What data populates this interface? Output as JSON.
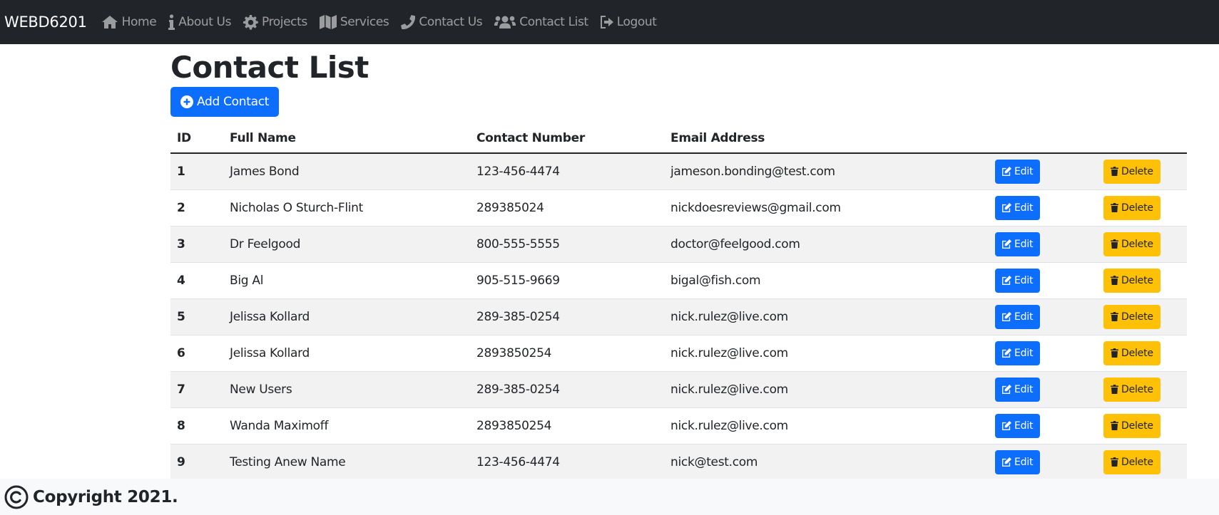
{
  "navbar": {
    "brand": "WEBD6201",
    "links": [
      {
        "label": "Home",
        "icon": "home-icon"
      },
      {
        "label": "About Us",
        "icon": "info-icon"
      },
      {
        "label": "Projects",
        "icon": "gear-icon"
      },
      {
        "label": "Services",
        "icon": "map-icon"
      },
      {
        "label": "Contact Us",
        "icon": "phone-icon"
      },
      {
        "label": "Contact List",
        "icon": "users-icon"
      },
      {
        "label": "Logout",
        "icon": "sign-out-icon"
      }
    ]
  },
  "main": {
    "title": "Contact List",
    "add_button": "Add Contact",
    "table": {
      "headers": [
        "ID",
        "Full Name",
        "Contact Number",
        "Email Address"
      ],
      "rows": [
        {
          "id": "1",
          "name": "James Bond",
          "number": "123-456-4474",
          "email": "jameson.bonding@test.com"
        },
        {
          "id": "2",
          "name": "Nicholas O Sturch-Flint",
          "number": "289385024",
          "email": "nickdoesreviews@gmail.com"
        },
        {
          "id": "3",
          "name": "Dr Feelgood",
          "number": "800-555-5555",
          "email": "doctor@feelgood.com"
        },
        {
          "id": "4",
          "name": "Big Al",
          "number": "905-515-9669",
          "email": "bigal@fish.com"
        },
        {
          "id": "5",
          "name": "Jelissa Kollard",
          "number": "289-385-0254",
          "email": "nick.rulez@live.com"
        },
        {
          "id": "6",
          "name": "Jelissa Kollard",
          "number": "2893850254",
          "email": "nick.rulez@live.com"
        },
        {
          "id": "7",
          "name": "New Users",
          "number": "289-385-0254",
          "email": "nick.rulez@live.com"
        },
        {
          "id": "8",
          "name": "Wanda Maximoff",
          "number": "2893850254",
          "email": "nick.rulez@live.com"
        },
        {
          "id": "9",
          "name": "Testing Anew Name",
          "number": "123-456-4474",
          "email": "nick@test.com"
        }
      ],
      "edit_label": "Edit",
      "delete_label": "Delete"
    }
  },
  "footer": {
    "text": "Copyright 2021."
  },
  "colors": {
    "navbar_bg": "#212529",
    "primary": "#0d6efd",
    "warning": "#ffc107",
    "stripe": "#f2f2f2"
  }
}
